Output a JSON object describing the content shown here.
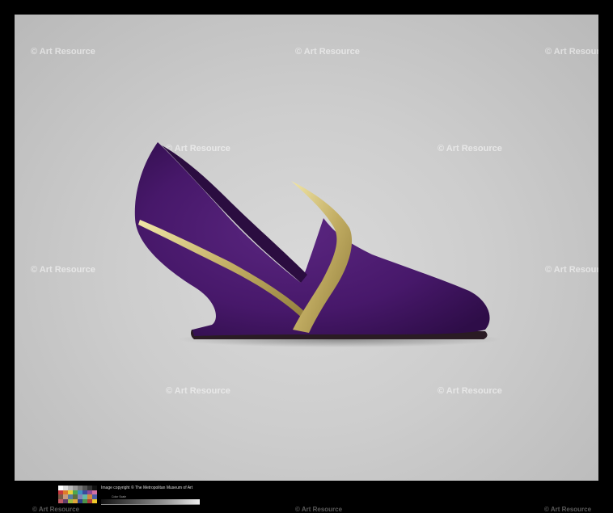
{
  "watermark": "© Art Resource",
  "caption": "Image copyright © The Metropolitan Museum of Art",
  "scale_label": "Color Scale",
  "colors": {
    "suede": "#4a1a6b",
    "suede_dark": "#2c0c44",
    "gold": "#c9b772",
    "background": "#cfcfcf"
  }
}
